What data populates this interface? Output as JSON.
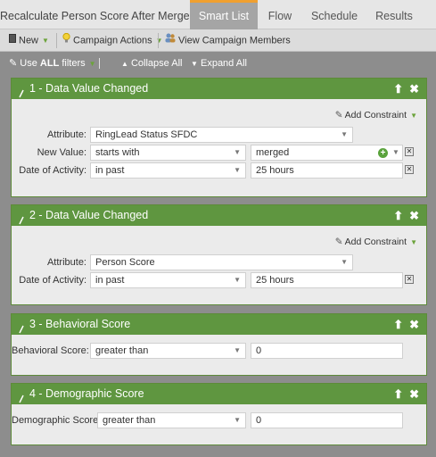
{
  "tabs": {
    "title": "Recalculate Person Score After Merge",
    "smart_list": "Smart List",
    "flow": "Flow",
    "schedule": "Schedule",
    "results": "Results"
  },
  "toolbar": {
    "new": "New",
    "campaign_actions": "Campaign Actions",
    "view_members": "View Campaign Members"
  },
  "filterbar": {
    "use_prefix": "Use ",
    "use_all": "ALL",
    "use_suffix": " filters",
    "collapse_all": "Collapse All",
    "expand_all": "Expand All"
  },
  "filters": [
    {
      "title": "1 - Data Value Changed",
      "add_constraint": "Add Constraint",
      "attribute_label": "Attribute:",
      "attribute_value": "RingLead Status SFDC",
      "new_value_label": "New Value:",
      "new_value_op": "starts with",
      "new_value_value": "merged",
      "date_label": "Date of Activity:",
      "date_op": "in past",
      "date_value": "25 hours"
    },
    {
      "title": "2 - Data Value Changed",
      "add_constraint": "Add Constraint",
      "attribute_label": "Attribute:",
      "attribute_value": "Person Score",
      "date_label": "Date of Activity:",
      "date_op": "in past",
      "date_value": "25 hours"
    },
    {
      "title": "3 - Behavioral Score",
      "label": "Behavioral Score:",
      "op": "greater than",
      "value": "0"
    },
    {
      "title": "4 - Demographic Score",
      "label": "Demographic Score:",
      "op": "greater than",
      "value": "0"
    }
  ],
  "colors": {
    "panel_header": "#5f9640",
    "active_tab_accent": "#f0a030",
    "background": "#8d8d8d"
  }
}
